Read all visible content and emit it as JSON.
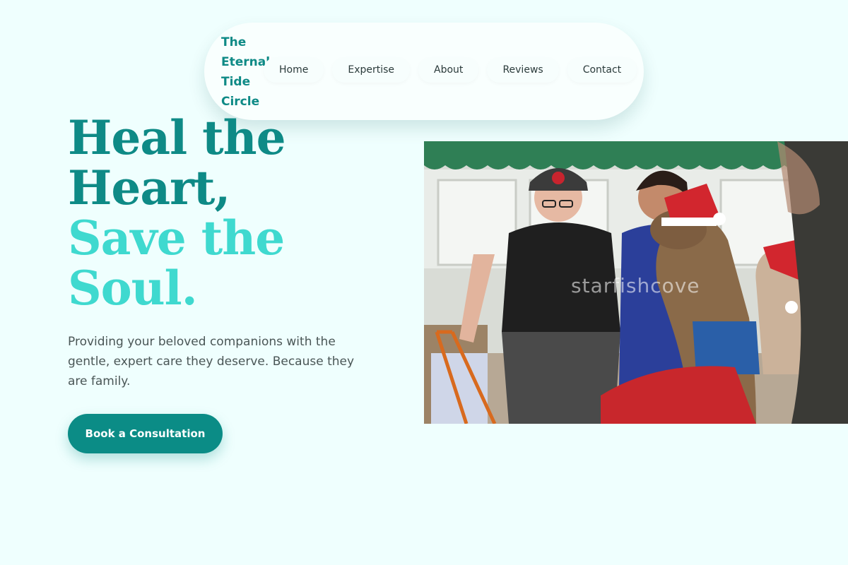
{
  "brand": {
    "name": "The\nEternal\nTide\nCircle"
  },
  "nav": {
    "items": [
      {
        "label": "Home"
      },
      {
        "label": "Expertise"
      },
      {
        "label": "About"
      },
      {
        "label": "Reviews"
      },
      {
        "label": "Contact"
      }
    ]
  },
  "hero": {
    "heading_line1": "Heal the",
    "heading_line2": "Heart,",
    "heading_line3": "Save the",
    "heading_line4": "Soul.",
    "description": "Providing your beloved companions with the gentle, expert care they deserve. Because they are family.",
    "cta_label": "Book a Consultation",
    "image_watermark": "starfishcove"
  },
  "colors": {
    "background": "#effffe",
    "primary": "#0e8a86",
    "accent": "#3fd9cf",
    "button": "#0b8c86"
  }
}
